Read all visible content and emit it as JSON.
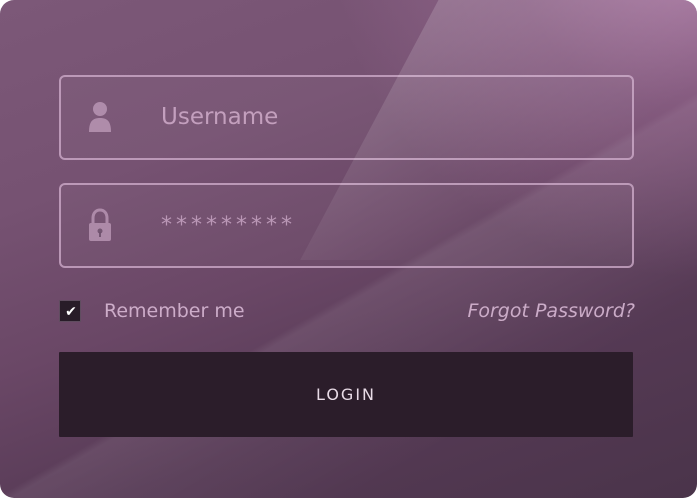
{
  "login_form": {
    "username": {
      "placeholder": "Username",
      "icon": "user-icon"
    },
    "password": {
      "value": "*********",
      "icon": "lock-icon"
    },
    "remember_me": {
      "label": "Remember me",
      "checked": true
    },
    "forgot_password": {
      "label": "Forgot Password?"
    },
    "login_button": {
      "label": "LOGIN"
    }
  },
  "colors": {
    "card_top": "#7c5878",
    "card_bottom": "#4a344a",
    "field_border": "#d2afcd",
    "button_bg": "#2b1d2a",
    "text": "#d6b2d0"
  }
}
